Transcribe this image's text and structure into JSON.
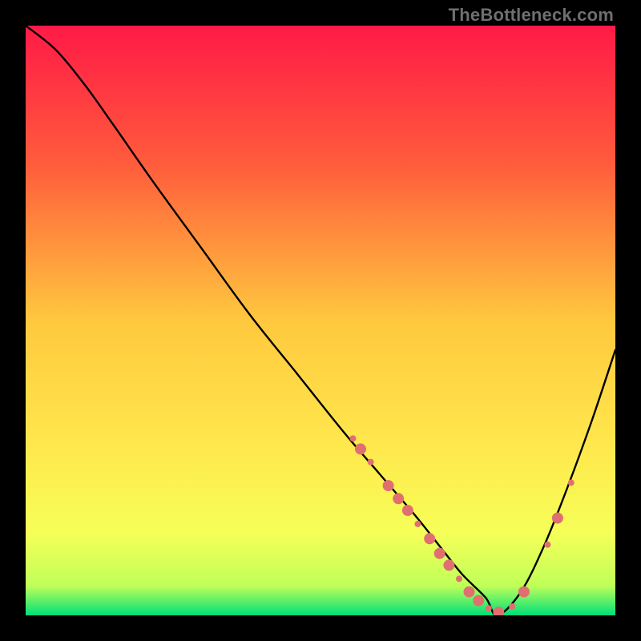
{
  "watermark": "TheBottleneck.com",
  "chart_data": {
    "type": "line",
    "title": "",
    "xlabel": "",
    "ylabel": "",
    "xlim": [
      0,
      100
    ],
    "ylim": [
      0,
      100
    ],
    "grid": false,
    "gradient_stops": [
      {
        "offset": 0,
        "color": "#ff1a47"
      },
      {
        "offset": 23,
        "color": "#ff5a3c"
      },
      {
        "offset": 50,
        "color": "#ffc83e"
      },
      {
        "offset": 72,
        "color": "#ffe94d"
      },
      {
        "offset": 86,
        "color": "#f6ff58"
      },
      {
        "offset": 95,
        "color": "#bfff58"
      },
      {
        "offset": 100,
        "color": "#00e07a"
      }
    ],
    "series": [
      {
        "name": "bottleneck-curve",
        "x": [
          0,
          5,
          10,
          15,
          22,
          30,
          38,
          46,
          54,
          60,
          66,
          70,
          74,
          78,
          80,
          84,
          88,
          92,
          96,
          100
        ],
        "y": [
          100,
          96,
          90,
          83,
          73,
          62,
          51,
          41,
          31,
          24,
          17,
          12,
          7,
          3,
          0,
          4,
          12,
          22,
          33,
          45
        ]
      }
    ],
    "markers": {
      "name": "highlight-dots",
      "color": "#e07070",
      "small_radius": 4,
      "large_radius": 7,
      "points": [
        {
          "x": 55.5,
          "y": 30.0,
          "r": "small"
        },
        {
          "x": 56.8,
          "y": 28.2,
          "r": "large"
        },
        {
          "x": 58.5,
          "y": 26.0,
          "r": "small"
        },
        {
          "x": 61.5,
          "y": 22.0,
          "r": "large"
        },
        {
          "x": 63.2,
          "y": 19.8,
          "r": "large"
        },
        {
          "x": 64.8,
          "y": 17.8,
          "r": "large"
        },
        {
          "x": 66.5,
          "y": 15.5,
          "r": "small"
        },
        {
          "x": 68.5,
          "y": 13.0,
          "r": "large"
        },
        {
          "x": 70.2,
          "y": 10.5,
          "r": "large"
        },
        {
          "x": 71.8,
          "y": 8.5,
          "r": "large"
        },
        {
          "x": 73.5,
          "y": 6.2,
          "r": "small"
        },
        {
          "x": 75.2,
          "y": 4.0,
          "r": "large"
        },
        {
          "x": 76.8,
          "y": 2.5,
          "r": "large"
        },
        {
          "x": 78.5,
          "y": 1.2,
          "r": "small"
        },
        {
          "x": 80.2,
          "y": 0.5,
          "r": "large"
        },
        {
          "x": 82.5,
          "y": 1.5,
          "r": "small"
        },
        {
          "x": 84.5,
          "y": 4.0,
          "r": "large"
        },
        {
          "x": 88.5,
          "y": 12.0,
          "r": "small"
        },
        {
          "x": 90.2,
          "y": 16.5,
          "r": "large"
        },
        {
          "x": 92.5,
          "y": 22.5,
          "r": "small"
        }
      ]
    }
  }
}
